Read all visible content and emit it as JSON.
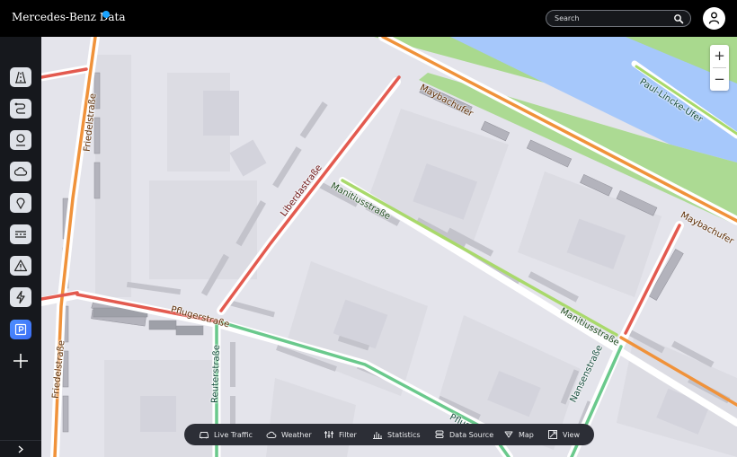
{
  "header": {
    "brand": "Mercedes-Benz Data",
    "search_placeholder": "Search",
    "accent_color": "#1aa3ff"
  },
  "sidebar": {
    "items": [
      {
        "icon": "road-icon"
      },
      {
        "icon": "route-icon"
      },
      {
        "icon": "location-pin-icon"
      },
      {
        "icon": "cloud-icon"
      },
      {
        "icon": "place-marker-icon"
      },
      {
        "icon": "lanes-icon"
      },
      {
        "icon": "warning-icon"
      },
      {
        "icon": "lightning-icon"
      },
      {
        "icon": "parking-icon",
        "active": true
      },
      {
        "icon": "plus-icon"
      }
    ],
    "expand_icon": "chevron-right-icon"
  },
  "map": {
    "zoom_in": "+",
    "zoom_out": "−",
    "labels": {
      "paul_lincke": "Paul-Lincke-Ufer",
      "maybachufer_1": "Maybachufer",
      "maybachufer_2": "Maybachufer",
      "friedel_1": "Friedelstraße",
      "friedel_2": "Friedelstraße",
      "liberda": "Liberdastraße",
      "manitius_1": "Manitiusstraße",
      "manitius_2": "Manitiusstraße",
      "pfluger_1": "Pflugerstraße",
      "pfluger_2": "Pfluge",
      "reuter": "Reuterstraße",
      "nansen": "Nansenstraße"
    },
    "colors": {
      "water": "#a6c8fb",
      "park": "#a9d98e",
      "traffic_heavy": "#e35a4f",
      "traffic_moderate": "#f0923a",
      "traffic_light": "#a9d96b",
      "traffic_free": "#6ac98c"
    }
  },
  "toolbar": {
    "items": [
      {
        "label": "Live Traffic",
        "icon": "car-icon"
      },
      {
        "label": "Weather",
        "icon": "cloud-icon"
      },
      {
        "label": "Filter",
        "icon": "sliders-icon"
      },
      {
        "label": "Statistics",
        "icon": "bar-chart-icon"
      },
      {
        "label": "Data Source",
        "icon": "database-icon"
      },
      {
        "label": "Map",
        "icon": "map-icon"
      },
      {
        "label": "View",
        "icon": "view-icon"
      }
    ]
  }
}
